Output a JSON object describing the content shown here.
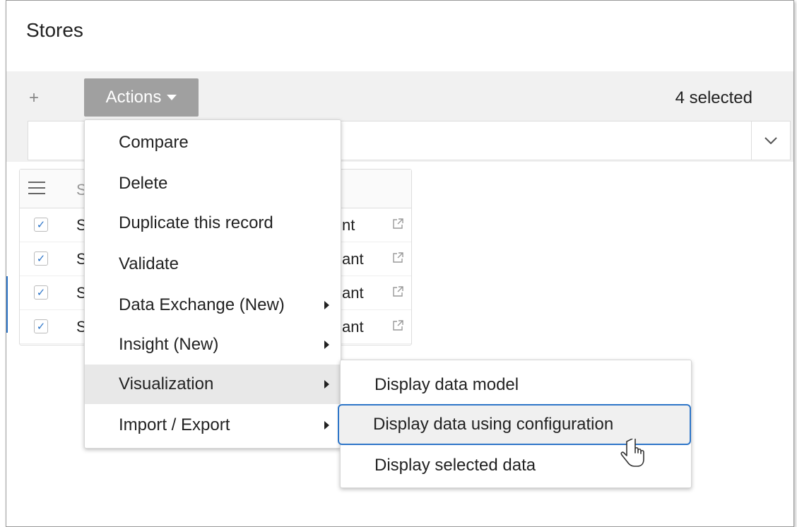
{
  "page": {
    "title": "Stores"
  },
  "toolbar": {
    "add_icon": "plus-icon",
    "actions_label": "Actions",
    "selected_count": "4 selected"
  },
  "grid": {
    "header_cell": "S",
    "rows": [
      {
        "checked": true,
        "name": "S",
        "tail": "nt"
      },
      {
        "checked": true,
        "name": "S",
        "tail": "ant"
      },
      {
        "checked": true,
        "name": "S",
        "tail": "ant"
      },
      {
        "checked": true,
        "name": "S",
        "tail": "ant"
      }
    ]
  },
  "menu": {
    "items": [
      {
        "label": "Compare",
        "has_submenu": false
      },
      {
        "label": "Delete",
        "has_submenu": false
      },
      {
        "label": "Duplicate this record",
        "has_submenu": false
      },
      {
        "label": "Validate",
        "has_submenu": false
      },
      {
        "label": "Data Exchange (New)",
        "has_submenu": true
      },
      {
        "label": "Insight (New)",
        "has_submenu": true
      },
      {
        "label": "Visualization",
        "has_submenu": true,
        "active": true
      },
      {
        "label": "Import / Export",
        "has_submenu": true
      }
    ]
  },
  "submenu": {
    "items": [
      {
        "label": "Display data model"
      },
      {
        "label": "Display data using configuration",
        "focused": true
      },
      {
        "label": "Display selected data"
      }
    ]
  },
  "colors": {
    "accent": "#2d75c8",
    "actions_bg": "#a0a0a0",
    "toolbar_bg": "#f1f1f1"
  }
}
